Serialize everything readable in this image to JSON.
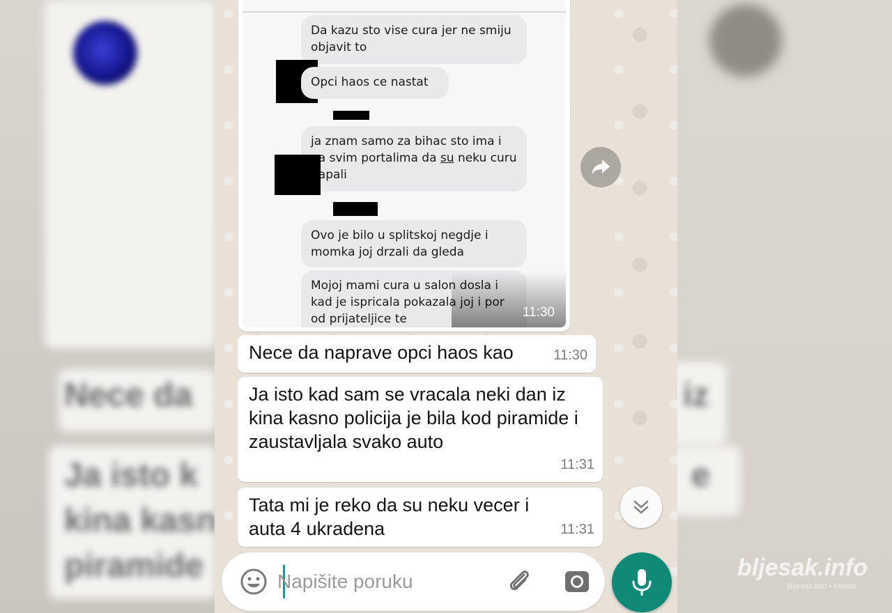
{
  "screenshot": {
    "messages": [
      {
        "text": "Da kazu sto vise cura jer ne smiju objavit to"
      },
      {
        "text": "Opci haos ce nastat"
      },
      {
        "text_before": "ja znam samo za bihac sto ima i na svim portalima da ",
        "underlined": "su",
        "text_after": " neku curu napali"
      },
      {
        "text": "Ovo je bilo u splitskoj negdje i momka joj drzali da gleda"
      },
      {
        "text": "Mojoj mami cura u salon dosla i kad je ispricala pokazala joj i por od prijateljice te"
      }
    ],
    "time": "11:30"
  },
  "chat": {
    "messages": [
      {
        "text": "Nece da naprave opci haos kao",
        "time": "11:30"
      },
      {
        "text": "Ja isto kad sam se vracala neki dan iz kina kasno policija je bila kod piramide i zaustavljala svako auto",
        "time": "11:31"
      },
      {
        "text": "Tata mi je reko da su neku vecer i auta 4 ukradena",
        "time": "11:31"
      }
    ]
  },
  "input": {
    "placeholder": "Napišite poruku"
  },
  "icons": {
    "emoji": "emoji-icon",
    "attach": "paperclip-icon",
    "camera": "camera-icon",
    "mic": "microphone-icon",
    "forward": "forward-arrow-icon",
    "scroll": "double-chevron-down-icon"
  },
  "colors": {
    "accent": "#0f8a76",
    "wallpaper": "#e7e1d8",
    "bubble": "#ffffff"
  },
  "watermark": {
    "brand": "bljesak.info",
    "sub": "Bljesak.info • Mostar"
  },
  "background_blur": {
    "left_fragments": [
      "Nece da",
      "Ja isto k",
      "kina kasn",
      "piramide"
    ],
    "right_fragments": [
      "iz",
      "e"
    ]
  }
}
